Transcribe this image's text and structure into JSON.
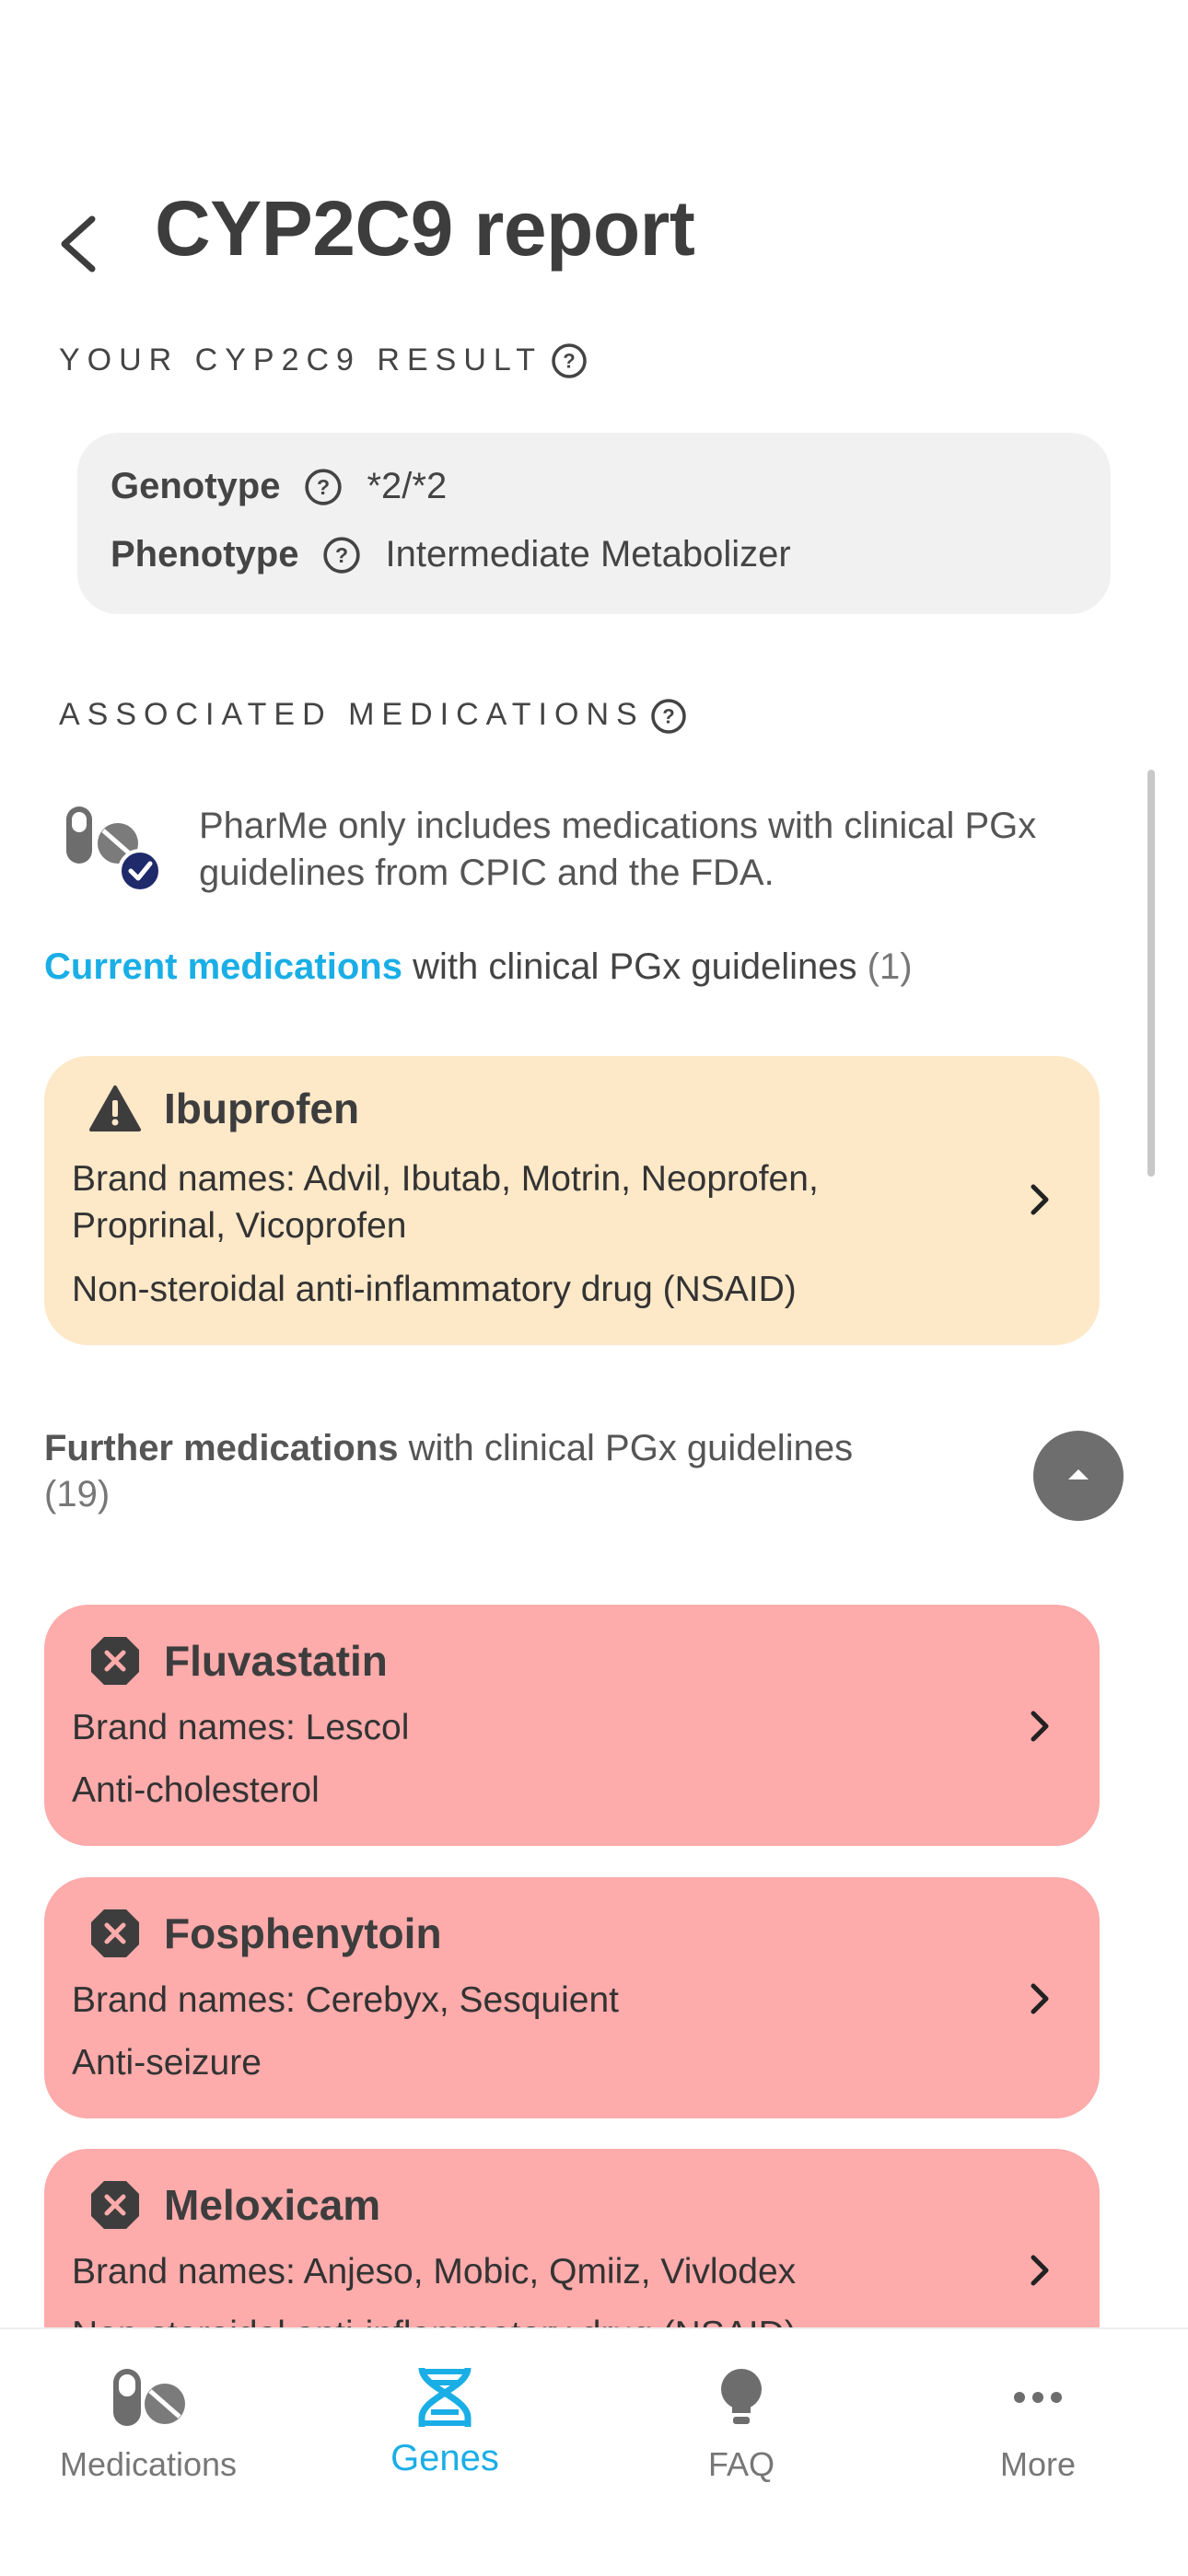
{
  "header": {
    "title": "CYP2C9 report"
  },
  "result_section": {
    "label": "YOUR CYP2C9 RESULT"
  },
  "result": {
    "genotype_label": "Genotype",
    "genotype_value": "*2/*2",
    "phenotype_label": "Phenotype",
    "phenotype_value": "Intermediate Metabolizer"
  },
  "medications_section": {
    "label": "ASSOCIATED MEDICATIONS"
  },
  "info": {
    "text": "PharMe only includes medications with clinical PGx guidelines from CPIC and the FDA."
  },
  "current": {
    "accent": "Current medications",
    "rest": " with clinical PGx guidelines ",
    "count": "(1)"
  },
  "current_cards": [
    {
      "name": "Ibuprofen",
      "brands_1": "Brand names: Advil, Ibutab, Motrin, Neoprofen,",
      "brands_2": "Proprinal, Vicoprofen",
      "class": "Non-steroidal anti-inflammatory drug (NSAID)",
      "status_icon": "warning-icon"
    }
  ],
  "further": {
    "bold": "Further medications",
    "rest": " with clinical PGx guidelines",
    "count": "(19)"
  },
  "further_cards": [
    {
      "name": "Fluvastatin",
      "brands": "Brand names: Lescol",
      "class": "Anti-cholesterol",
      "status_icon": "cancel-icon"
    },
    {
      "name": "Fosphenytoin",
      "brands": "Brand names: Cerebyx, Sesquient",
      "class": "Anti-seizure",
      "status_icon": "cancel-icon"
    },
    {
      "name": "Meloxicam",
      "brands": "Brand names: Anjeso, Mobic, Qmiiz, Vivlodex",
      "class": "Non-steroidal anti-inflammatory drug (NSAID)",
      "status_icon": "cancel-icon"
    }
  ],
  "nav": {
    "items": [
      {
        "label": "Medications",
        "icon": "pill-icon"
      },
      {
        "label": "Genes",
        "icon": "dna-icon",
        "active": true
      },
      {
        "label": "FAQ",
        "icon": "lightbulb-icon"
      },
      {
        "label": "More",
        "icon": "more-icon"
      }
    ]
  },
  "colors": {
    "accent": "#1aaee6",
    "warning_card": "#fde8c8",
    "danger_card": "#fdabab",
    "info_badge": "#1f2a6b"
  }
}
